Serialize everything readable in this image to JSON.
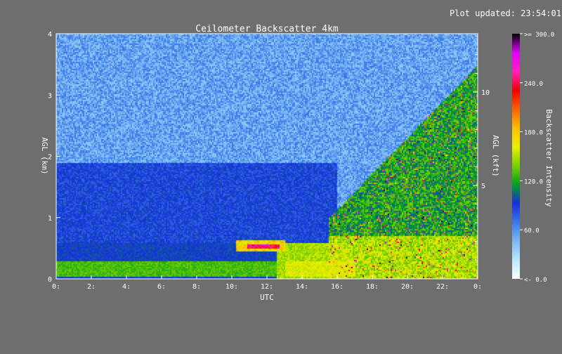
{
  "header": {
    "updated_label": "Plot updated:",
    "updated_time": "23:54:01"
  },
  "chart_data": {
    "type": "heatmap",
    "title": "Ceilometer Backscatter 4km",
    "xlabel": "UTC",
    "ylabel": "AGL (km)",
    "y2label": "AGL (kft)",
    "colorbar_label": "Backscatter Intensity",
    "x_range": [
      0,
      24
    ],
    "x_ticks": [
      "0:",
      "2:",
      "4:",
      "6:",
      "8:",
      "10:",
      "12:",
      "14:",
      "16:",
      "18:",
      "20:",
      "22:",
      "0:"
    ],
    "y_range": [
      0,
      4
    ],
    "y_ticks": [
      "0",
      "1",
      "2",
      "3",
      "4"
    ],
    "y2_range_kft": [
      0,
      13.12
    ],
    "y2_ticks": [
      "5",
      "10"
    ],
    "colorbar_ticks": [
      {
        "value": 0,
        "label": "<-   0.0"
      },
      {
        "value": 60,
        "label": "60.0"
      },
      {
        "value": 120,
        "label": "120.0"
      },
      {
        "value": 180,
        "label": "180.0"
      },
      {
        "value": 240,
        "label": "240.0"
      },
      {
        "value": 300,
        "label": ">= 300.0"
      }
    ],
    "colorbar_range": [
      0,
      300
    ],
    "colormap": [
      "#ffffff",
      "#b8e6ff",
      "#7ab8f5",
      "#3a78e8",
      "#1530d8",
      "#00a020",
      "#7ad000",
      "#e8f000",
      "#ffc000",
      "#ff6000",
      "#f00000",
      "#ff20c0",
      "#e000ff",
      "#000000"
    ],
    "background_color": "#6e6e6e",
    "features": [
      {
        "name": "surface layer",
        "start": 0,
        "end": 24,
        "base_km": 0.05,
        "top_km": 0.3
      },
      {
        "name": "boundary layer",
        "start": 0,
        "end": 16,
        "top_km": 1.9
      },
      {
        "name": "cloud layer",
        "start": 10.2,
        "end": 13.0,
        "base_km": 0.45,
        "top_km": 0.65
      },
      {
        "name": "precipitation",
        "start": 15.5,
        "end": 24,
        "top_km": 3.5
      }
    ]
  }
}
